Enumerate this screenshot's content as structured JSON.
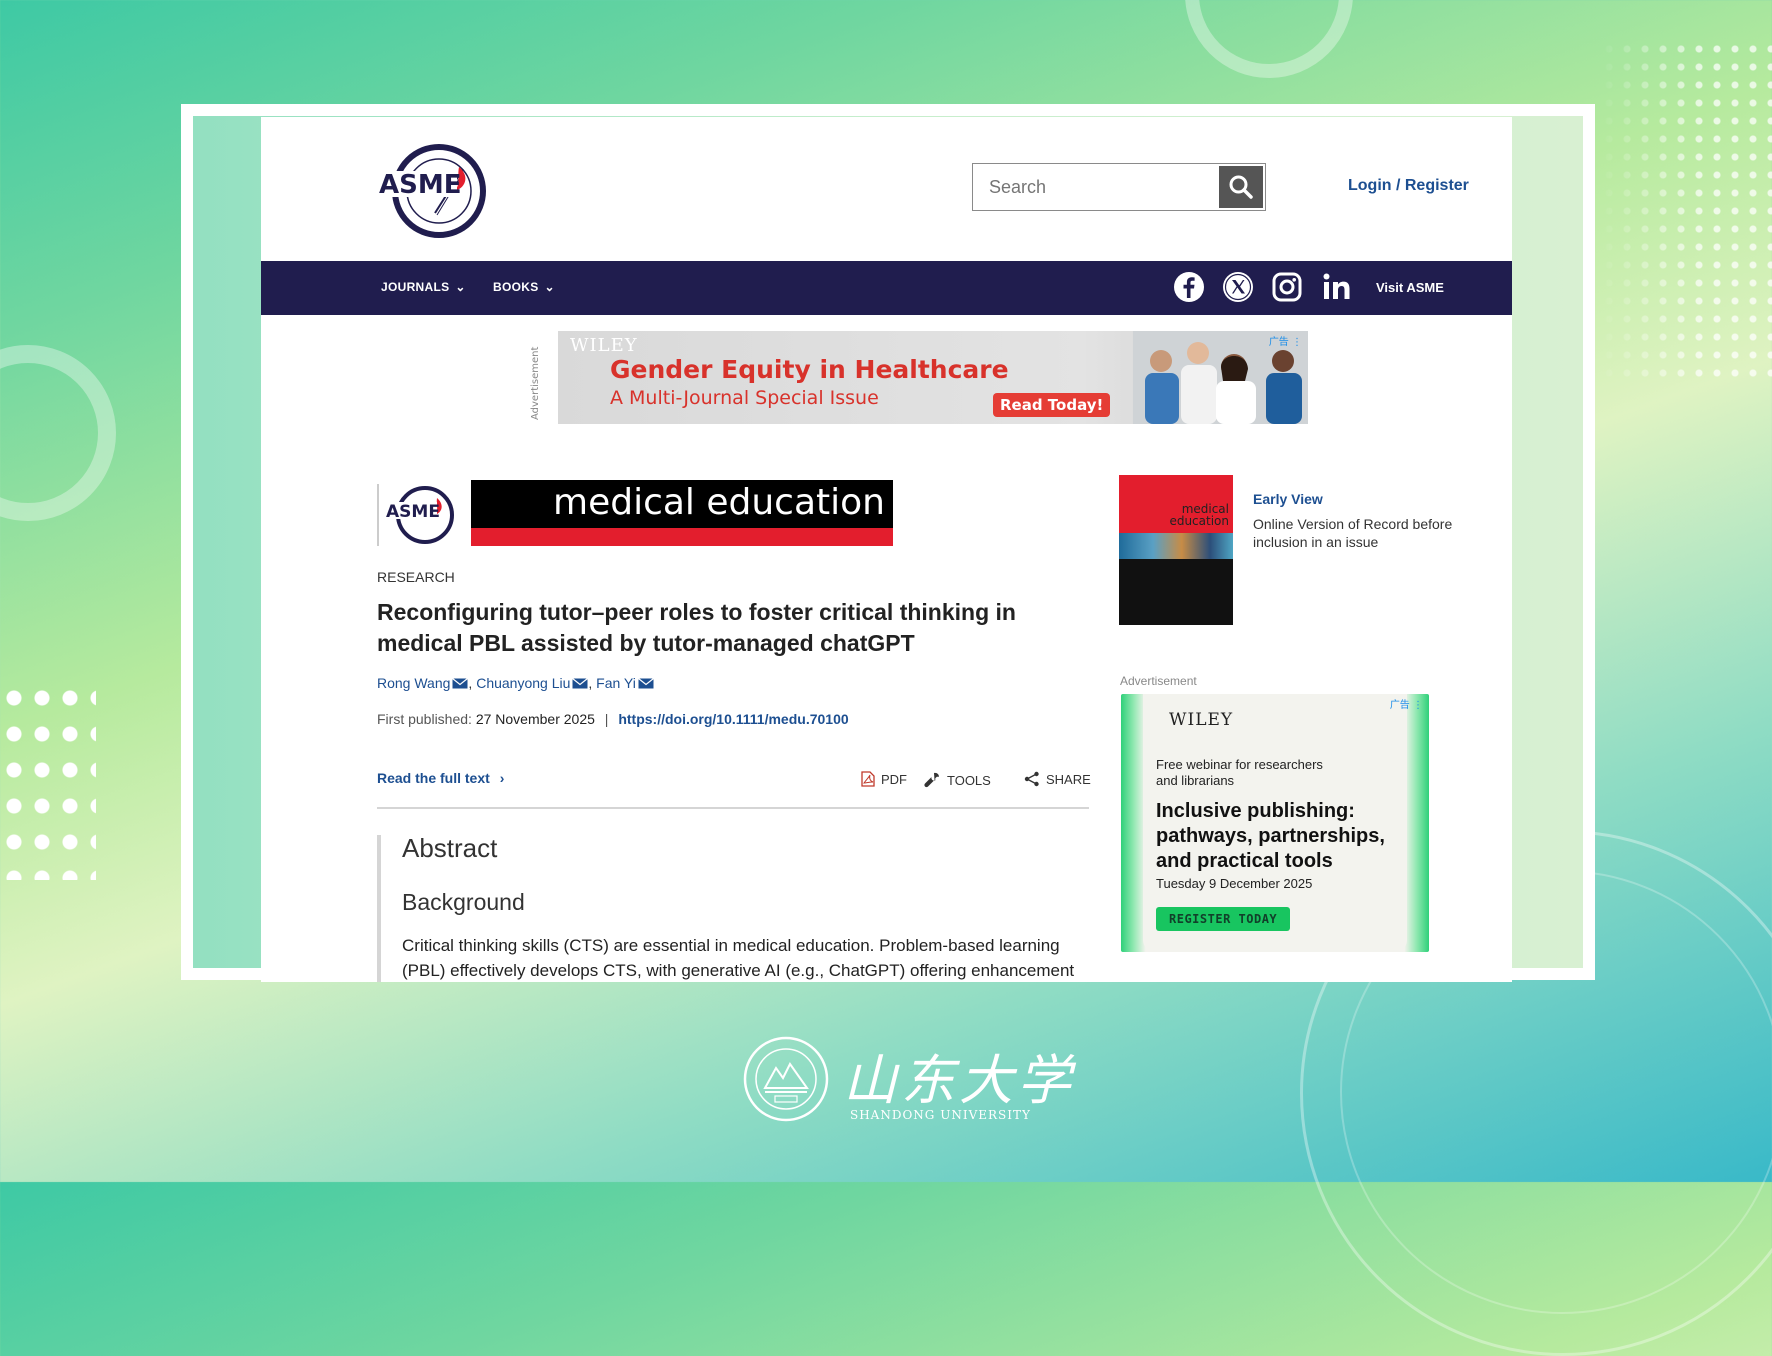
{
  "site": {
    "logo_text": "ASME",
    "search_placeholder": "Search",
    "login": "Login / Register"
  },
  "nav": {
    "journals": "JOURNALS",
    "books": "BOOKS",
    "visit": "Visit ASME",
    "social_icons": [
      "facebook-icon",
      "x-icon",
      "instagram-icon",
      "linkedin-icon"
    ]
  },
  "ad_banner": {
    "label": "Advertisement",
    "brand": "WILEY",
    "title": "Gender Equity in Healthcare",
    "subtitle": "A Multi-Journal Special Issue",
    "button": "Read Today!",
    "mark": "广告 ⋮"
  },
  "journal": {
    "logo_text": "ASME",
    "banner_text": "medical education"
  },
  "article": {
    "category": "RESEARCH",
    "title": "Reconfiguring tutor–peer roles to foster critical thinking in medical PBL assisted by tutor-managed chatGPT",
    "authors": [
      "Rong Wang",
      "Chuanyong Liu",
      "Fan Yi"
    ],
    "first_published_label": "First published:",
    "first_published_date": "27 November 2025",
    "separator": "|",
    "doi": "https://doi.org/10.1111/medu.70100",
    "read_full": "Read the full text",
    "tools": {
      "pdf": "PDF",
      "tools": "TOOLS",
      "share": "SHARE"
    },
    "abstract_heading": "Abstract",
    "background_heading": "Background",
    "abstract_text": "Critical thinking skills (CTS) are essential in medical education. Problem-based learning (PBL) effectively develops CTS, with generative AI (e.g., ChatGPT) offering enhancement"
  },
  "sidebar": {
    "cover_text_1": "medical",
    "cover_text_2": "education",
    "early_view_title": "Early View",
    "early_view_text": "Online Version of Record before inclusion in an issue",
    "ad_label": "Advertisement",
    "ad": {
      "brand": "WILEY",
      "line1": "Free webinar for researchers",
      "line2": "and librarians",
      "headline": "Inclusive publishing: pathways, partnerships, and practical tools",
      "date": "Tuesday 9 December 2025",
      "button": "REGISTER TODAY",
      "mark": "广告 ⋮"
    }
  },
  "footer": {
    "university_cn": "山东大学",
    "university_en": "SHANDONG UNIVERSITY"
  },
  "colors": {
    "navbar": "#201d4e",
    "link": "#1d4f91",
    "ad_red": "#d8322b",
    "journal_red": "#e31e2d"
  }
}
